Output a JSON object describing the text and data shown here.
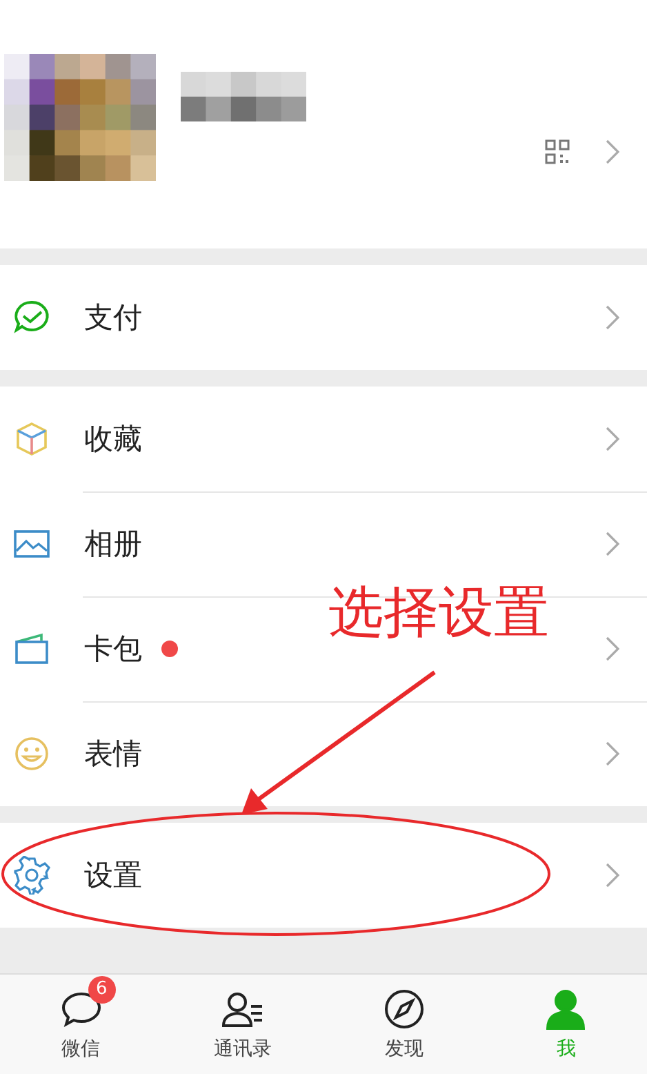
{
  "groups": [
    {
      "items": [
        {
          "label": "支付",
          "kind": "pay",
          "dot": false
        }
      ]
    },
    {
      "items": [
        {
          "label": "收藏",
          "kind": "cube",
          "dot": false
        },
        {
          "label": "相册",
          "kind": "album",
          "dot": false
        },
        {
          "label": "卡包",
          "kind": "card",
          "dot": true
        },
        {
          "label": "表情",
          "kind": "smile",
          "dot": false
        }
      ]
    },
    {
      "items": [
        {
          "label": "设置",
          "kind": "gear",
          "dot": false
        }
      ]
    }
  ],
  "annotation": {
    "text": "选择设置",
    "color": "#e8292b"
  },
  "tabs": [
    {
      "label": "微信",
      "kind": "chat",
      "badge": "6",
      "selected": false
    },
    {
      "label": "通讯录",
      "kind": "contacts",
      "selected": false
    },
    {
      "label": "发现",
      "kind": "compass",
      "selected": false
    },
    {
      "label": "我",
      "kind": "me",
      "selected": true
    }
  ]
}
